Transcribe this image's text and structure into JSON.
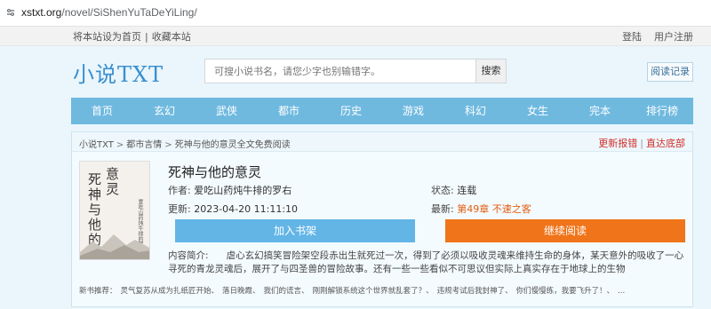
{
  "browser": {
    "url_host": "xstxt.org",
    "url_path": "/novel/SiShenYuTaDeYiLing/"
  },
  "topbar": {
    "set_home": "将本站设为首页",
    "separator": "|",
    "bookmark": "收藏本站",
    "login": "登陆",
    "register": "用户注册"
  },
  "header": {
    "logo": "小说TXT",
    "search_placeholder": "可搜小说书名，请您少字也别输错字。",
    "search_button": "搜索",
    "history": "阅读记录"
  },
  "nav": {
    "items": [
      "首页",
      "玄幻",
      "武侠",
      "都市",
      "历史",
      "游戏",
      "科幻",
      "女生",
      "完本",
      "排行榜"
    ]
  },
  "breadcrumb": {
    "home": "小说TXT",
    "category": "都市言情",
    "current": "死神与他的意灵全文免费阅读",
    "arrow": ">",
    "report": "更新报错",
    "bar": "|",
    "bottom": "直达底部"
  },
  "book": {
    "cover_title_a": "意灵",
    "cover_title_b": "死神与他的",
    "cover_author": "爱吃山药炖牛排的罗右 著",
    "title": "死神与他的意灵",
    "author_label": "作者:",
    "author": "爱吃山药炖牛排的罗右",
    "status_label": "状态:",
    "status": "连载",
    "updated_label": "更新:",
    "updated": "2023-04-20 11:11:10",
    "latest_label": "最新:",
    "latest": "第49章 不速之客",
    "add_shelf": "加入书架",
    "continue_read": "继续阅读",
    "intro_label": "内容简介:",
    "intro_text": "虐心玄幻搞笑冒险架空段赤出生就死过一次，得到了必须以吸收灵魂来维持生命的身体，某天意外的吸收了一心寻死的青龙灵魂后，展开了与四圣兽的冒险故事。还有一些一些看似不可思议但实际上真实存在于地球上的生物"
  },
  "recommend": {
    "label": "新书推荐：",
    "items": [
      "灵气复苏从成为扎纸匠开始、",
      "落日晚霞、",
      "我们的谎言、",
      "刚刚解锁系统这个世界就乱套了？、",
      "违规考试后我封神了、",
      "你们慢慢练，我要飞升了！、",
      "..."
    ]
  }
}
